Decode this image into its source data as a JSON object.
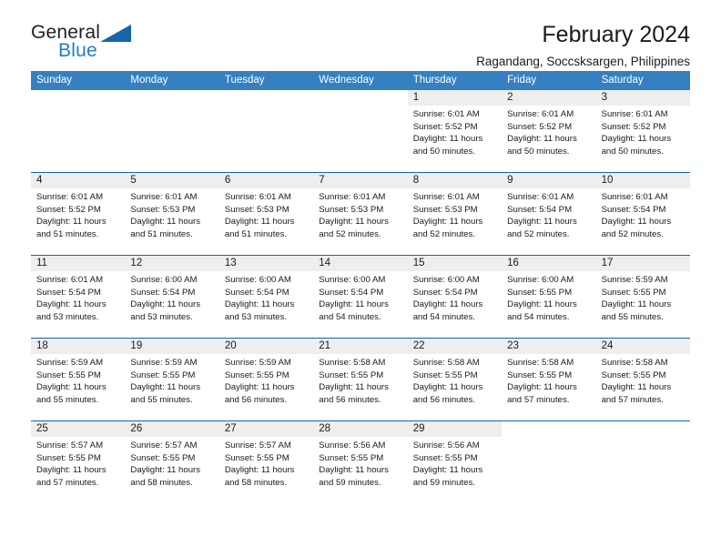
{
  "brand": {
    "name_top": "General",
    "name_bottom": "Blue",
    "accent_color": "#1f7ec4",
    "triangle_color": "#1565a8",
    "logo_icon": "triangle-icon"
  },
  "header": {
    "title": "February 2024",
    "subtitle": "Ragandang, Soccsksargen, Philippines"
  },
  "calendar": {
    "header_bg": "#3580c0",
    "row_separator_color": "#1565a8",
    "daynum_bar_bg": "#eeeeee",
    "weekdays": [
      "Sunday",
      "Monday",
      "Tuesday",
      "Wednesday",
      "Thursday",
      "Friday",
      "Saturday"
    ],
    "weeks": [
      [
        {
          "day": "",
          "sunrise": "",
          "sunset": "",
          "daylight_line1": "",
          "daylight_line2": ""
        },
        {
          "day": "",
          "sunrise": "",
          "sunset": "",
          "daylight_line1": "",
          "daylight_line2": ""
        },
        {
          "day": "",
          "sunrise": "",
          "sunset": "",
          "daylight_line1": "",
          "daylight_line2": ""
        },
        {
          "day": "",
          "sunrise": "",
          "sunset": "",
          "daylight_line1": "",
          "daylight_line2": ""
        },
        {
          "day": "1",
          "sunrise": "Sunrise: 6:01 AM",
          "sunset": "Sunset: 5:52 PM",
          "daylight_line1": "Daylight: 11 hours",
          "daylight_line2": "and 50 minutes."
        },
        {
          "day": "2",
          "sunrise": "Sunrise: 6:01 AM",
          "sunset": "Sunset: 5:52 PM",
          "daylight_line1": "Daylight: 11 hours",
          "daylight_line2": "and 50 minutes."
        },
        {
          "day": "3",
          "sunrise": "Sunrise: 6:01 AM",
          "sunset": "Sunset: 5:52 PM",
          "daylight_line1": "Daylight: 11 hours",
          "daylight_line2": "and 50 minutes."
        }
      ],
      [
        {
          "day": "4",
          "sunrise": "Sunrise: 6:01 AM",
          "sunset": "Sunset: 5:52 PM",
          "daylight_line1": "Daylight: 11 hours",
          "daylight_line2": "and 51 minutes."
        },
        {
          "day": "5",
          "sunrise": "Sunrise: 6:01 AM",
          "sunset": "Sunset: 5:53 PM",
          "daylight_line1": "Daylight: 11 hours",
          "daylight_line2": "and 51 minutes."
        },
        {
          "day": "6",
          "sunrise": "Sunrise: 6:01 AM",
          "sunset": "Sunset: 5:53 PM",
          "daylight_line1": "Daylight: 11 hours",
          "daylight_line2": "and 51 minutes."
        },
        {
          "day": "7",
          "sunrise": "Sunrise: 6:01 AM",
          "sunset": "Sunset: 5:53 PM",
          "daylight_line1": "Daylight: 11 hours",
          "daylight_line2": "and 52 minutes."
        },
        {
          "day": "8",
          "sunrise": "Sunrise: 6:01 AM",
          "sunset": "Sunset: 5:53 PM",
          "daylight_line1": "Daylight: 11 hours",
          "daylight_line2": "and 52 minutes."
        },
        {
          "day": "9",
          "sunrise": "Sunrise: 6:01 AM",
          "sunset": "Sunset: 5:54 PM",
          "daylight_line1": "Daylight: 11 hours",
          "daylight_line2": "and 52 minutes."
        },
        {
          "day": "10",
          "sunrise": "Sunrise: 6:01 AM",
          "sunset": "Sunset: 5:54 PM",
          "daylight_line1": "Daylight: 11 hours",
          "daylight_line2": "and 52 minutes."
        }
      ],
      [
        {
          "day": "11",
          "sunrise": "Sunrise: 6:01 AM",
          "sunset": "Sunset: 5:54 PM",
          "daylight_line1": "Daylight: 11 hours",
          "daylight_line2": "and 53 minutes."
        },
        {
          "day": "12",
          "sunrise": "Sunrise: 6:00 AM",
          "sunset": "Sunset: 5:54 PM",
          "daylight_line1": "Daylight: 11 hours",
          "daylight_line2": "and 53 minutes."
        },
        {
          "day": "13",
          "sunrise": "Sunrise: 6:00 AM",
          "sunset": "Sunset: 5:54 PM",
          "daylight_line1": "Daylight: 11 hours",
          "daylight_line2": "and 53 minutes."
        },
        {
          "day": "14",
          "sunrise": "Sunrise: 6:00 AM",
          "sunset": "Sunset: 5:54 PM",
          "daylight_line1": "Daylight: 11 hours",
          "daylight_line2": "and 54 minutes."
        },
        {
          "day": "15",
          "sunrise": "Sunrise: 6:00 AM",
          "sunset": "Sunset: 5:54 PM",
          "daylight_line1": "Daylight: 11 hours",
          "daylight_line2": "and 54 minutes."
        },
        {
          "day": "16",
          "sunrise": "Sunrise: 6:00 AM",
          "sunset": "Sunset: 5:55 PM",
          "daylight_line1": "Daylight: 11 hours",
          "daylight_line2": "and 54 minutes."
        },
        {
          "day": "17",
          "sunrise": "Sunrise: 5:59 AM",
          "sunset": "Sunset: 5:55 PM",
          "daylight_line1": "Daylight: 11 hours",
          "daylight_line2": "and 55 minutes."
        }
      ],
      [
        {
          "day": "18",
          "sunrise": "Sunrise: 5:59 AM",
          "sunset": "Sunset: 5:55 PM",
          "daylight_line1": "Daylight: 11 hours",
          "daylight_line2": "and 55 minutes."
        },
        {
          "day": "19",
          "sunrise": "Sunrise: 5:59 AM",
          "sunset": "Sunset: 5:55 PM",
          "daylight_line1": "Daylight: 11 hours",
          "daylight_line2": "and 55 minutes."
        },
        {
          "day": "20",
          "sunrise": "Sunrise: 5:59 AM",
          "sunset": "Sunset: 5:55 PM",
          "daylight_line1": "Daylight: 11 hours",
          "daylight_line2": "and 56 minutes."
        },
        {
          "day": "21",
          "sunrise": "Sunrise: 5:58 AM",
          "sunset": "Sunset: 5:55 PM",
          "daylight_line1": "Daylight: 11 hours",
          "daylight_line2": "and 56 minutes."
        },
        {
          "day": "22",
          "sunrise": "Sunrise: 5:58 AM",
          "sunset": "Sunset: 5:55 PM",
          "daylight_line1": "Daylight: 11 hours",
          "daylight_line2": "and 56 minutes."
        },
        {
          "day": "23",
          "sunrise": "Sunrise: 5:58 AM",
          "sunset": "Sunset: 5:55 PM",
          "daylight_line1": "Daylight: 11 hours",
          "daylight_line2": "and 57 minutes."
        },
        {
          "day": "24",
          "sunrise": "Sunrise: 5:58 AM",
          "sunset": "Sunset: 5:55 PM",
          "daylight_line1": "Daylight: 11 hours",
          "daylight_line2": "and 57 minutes."
        }
      ],
      [
        {
          "day": "25",
          "sunrise": "Sunrise: 5:57 AM",
          "sunset": "Sunset: 5:55 PM",
          "daylight_line1": "Daylight: 11 hours",
          "daylight_line2": "and 57 minutes."
        },
        {
          "day": "26",
          "sunrise": "Sunrise: 5:57 AM",
          "sunset": "Sunset: 5:55 PM",
          "daylight_line1": "Daylight: 11 hours",
          "daylight_line2": "and 58 minutes."
        },
        {
          "day": "27",
          "sunrise": "Sunrise: 5:57 AM",
          "sunset": "Sunset: 5:55 PM",
          "daylight_line1": "Daylight: 11 hours",
          "daylight_line2": "and 58 minutes."
        },
        {
          "day": "28",
          "sunrise": "Sunrise: 5:56 AM",
          "sunset": "Sunset: 5:55 PM",
          "daylight_line1": "Daylight: 11 hours",
          "daylight_line2": "and 59 minutes."
        },
        {
          "day": "29",
          "sunrise": "Sunrise: 5:56 AM",
          "sunset": "Sunset: 5:55 PM",
          "daylight_line1": "Daylight: 11 hours",
          "daylight_line2": "and 59 minutes."
        },
        {
          "day": "",
          "sunrise": "",
          "sunset": "",
          "daylight_line1": "",
          "daylight_line2": ""
        },
        {
          "day": "",
          "sunrise": "",
          "sunset": "",
          "daylight_line1": "",
          "daylight_line2": ""
        }
      ]
    ]
  }
}
